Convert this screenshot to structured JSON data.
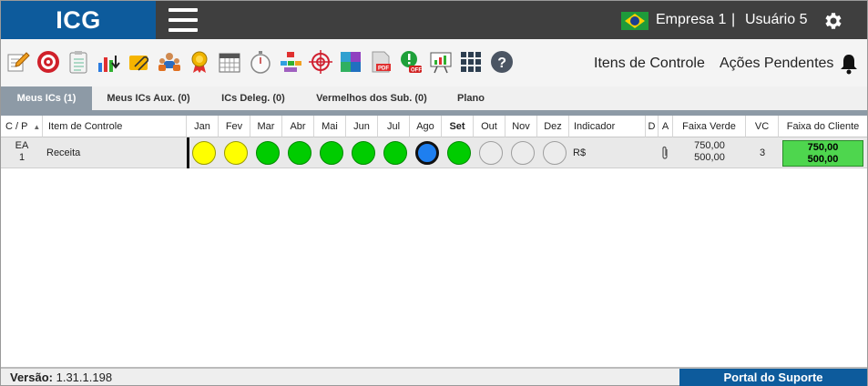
{
  "header": {
    "logo": "ICG",
    "company": "Empresa 1",
    "separator": "|",
    "user": "Usuário 5"
  },
  "toolbar": {
    "icons": [
      "edit-icon",
      "target-icon",
      "checklist-icon",
      "chart-download-icon",
      "paperclip-icon",
      "team-icon",
      "award-icon",
      "calendar-icon",
      "stopwatch-icon",
      "org-chart-icon",
      "crosshair-icon",
      "puzzle-icon",
      "pdf-icon",
      "alert-off-icon",
      "presentation-icon",
      "grid-icon",
      "help-icon"
    ],
    "links": [
      "Itens de Controle",
      "Ações Pendentes"
    ]
  },
  "tabs": [
    {
      "label": "Meus ICs (1)",
      "active": true
    },
    {
      "label": "Meus ICs Aux. (0)",
      "active": false
    },
    {
      "label": "ICs Deleg. (0)",
      "active": false
    },
    {
      "label": "Vermelhos dos Sub. (0)",
      "active": false
    },
    {
      "label": "Plano",
      "active": false
    }
  ],
  "table": {
    "headers": {
      "cp": "C / P",
      "item": "Item de Controle",
      "months": [
        "Jan",
        "Fev",
        "Mar",
        "Abr",
        "Mai",
        "Jun",
        "Jul",
        "Ago",
        "Set",
        "Out",
        "Nov",
        "Dez"
      ],
      "indicador": "Indicador",
      "d": "D",
      "a": "A",
      "faixa_verde": "Faixa Verde",
      "vc": "VC",
      "faixa_cliente": "Faixa do Cliente"
    },
    "rows": [
      {
        "cp_line1": "EA",
        "cp_line2": "1",
        "item": "Receita",
        "month_status": [
          "yellow",
          "yellow",
          "green",
          "green",
          "green",
          "green",
          "green",
          "blue-current",
          "green",
          "empty",
          "empty",
          "empty"
        ],
        "indicador": "R$",
        "faixa_verde_1": "750,00",
        "faixa_verde_2": "500,00",
        "vc": "3",
        "faixa_cliente_1": "750,00",
        "faixa_cliente_2": "500,00"
      }
    ]
  },
  "footer": {
    "version_label": "Versão:",
    "version_value": "1.31.1.198",
    "portal": "Portal do Suporte"
  },
  "colors": {
    "brand_blue": "#0d5b9c",
    "topbar": "#3f3f3f",
    "status_yellow": "#ffff00",
    "status_green": "#00cc00",
    "status_blue": "#1e7ff0",
    "client_band": "#4ed64e"
  }
}
